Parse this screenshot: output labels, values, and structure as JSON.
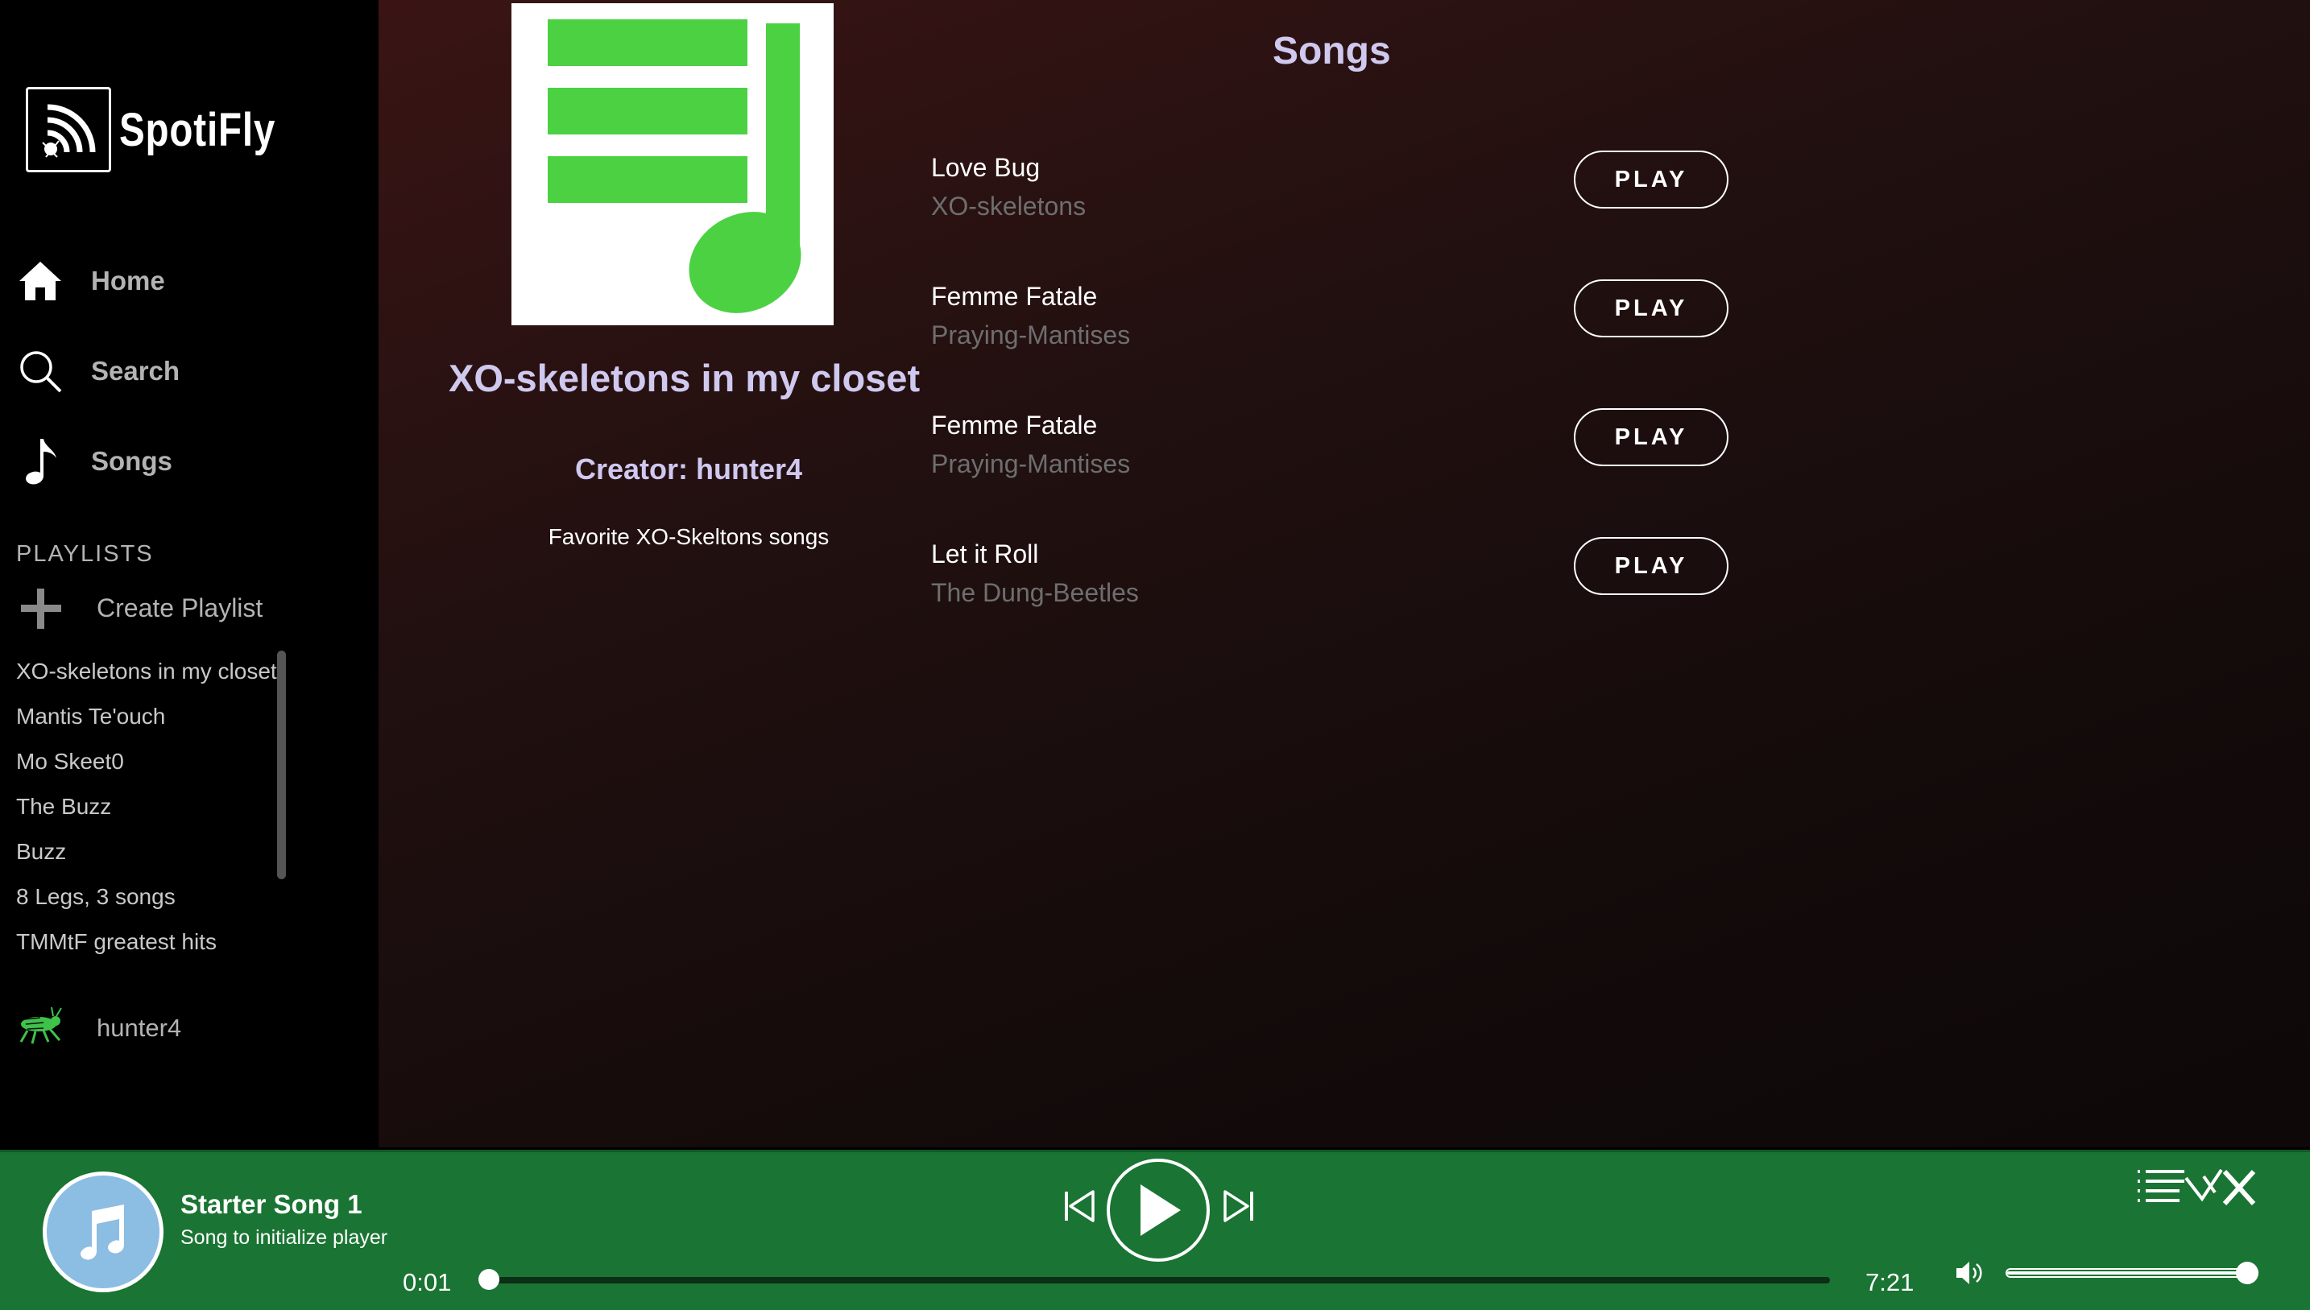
{
  "app": {
    "name": "SpotiFly"
  },
  "nav": [
    {
      "label": "Home",
      "icon": "home-icon"
    },
    {
      "label": "Search",
      "icon": "search-icon"
    },
    {
      "label": "Songs",
      "icon": "music-note-icon"
    }
  ],
  "playlists": {
    "heading": "PLAYLISTS",
    "create_label": "Create Playlist",
    "items": [
      "XO-skeletons in my closet",
      "Mantis Te'ouch",
      "Mo Skeet0",
      "The Buzz",
      "Buzz",
      "8 Legs, 3 songs",
      "TMMtF greatest hits"
    ]
  },
  "user": {
    "name": "hunter4",
    "icon": "grasshopper-icon"
  },
  "playlist_detail": {
    "title": "XO-skeletons in my closet",
    "creator": "Creator: hunter4",
    "description": "Favorite XO-Skeltons songs",
    "cover_color": "#4cd143"
  },
  "songs": {
    "heading": "Songs",
    "play_label": "PLAY",
    "items": [
      {
        "name": "Love Bug",
        "artist": "XO-skeletons"
      },
      {
        "name": "Femme Fatale",
        "artist": "Praying-Mantises"
      },
      {
        "name": "Femme Fatale",
        "artist": "Praying-Mantises"
      },
      {
        "name": "Let it Roll",
        "artist": "The Dung-Beetles"
      }
    ]
  },
  "player": {
    "title": "Starter Song 1",
    "subtitle": "Song to initialize player",
    "current_time": "0:01",
    "duration": "7:21",
    "progress": 0.002,
    "volume": 1.0,
    "bar_color": "#1a7433"
  }
}
